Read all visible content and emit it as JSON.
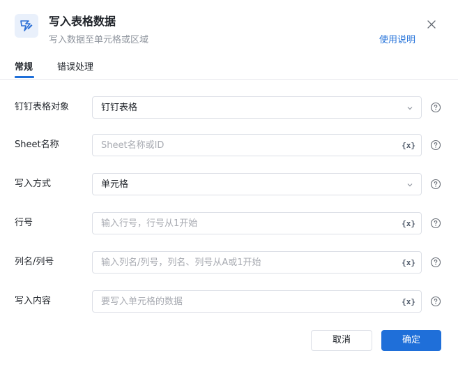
{
  "header": {
    "title": "写入表格数据",
    "subtitle": "写入数据至单元格或区域",
    "help_link": "使用说明"
  },
  "tabs": [
    {
      "label": "常规",
      "active": true
    },
    {
      "label": "错误处理",
      "active": false
    }
  ],
  "form": {
    "rows": [
      {
        "label": "钉钉表格对象",
        "type": "select",
        "value": "钉钉表格",
        "placeholder": ""
      },
      {
        "label": "Sheet名称",
        "type": "input",
        "value": "",
        "placeholder": "Sheet名称或ID"
      },
      {
        "label": "写入方式",
        "type": "select",
        "value": "单元格",
        "placeholder": ""
      },
      {
        "label": "行号",
        "type": "input",
        "value": "",
        "placeholder": "输入行号，行号从1开始"
      },
      {
        "label": "列名/列号",
        "type": "input",
        "value": "",
        "placeholder": "输入列名/列号，列名、列号从A或1开始"
      },
      {
        "label": "写入内容",
        "type": "input",
        "value": "",
        "placeholder": "要写入单元格的数据"
      }
    ],
    "var_icon_text": "{x}"
  },
  "footer": {
    "cancel_label": "取消",
    "ok_label": "确定"
  },
  "colors": {
    "accent": "#1f6fd9",
    "border": "#dcdfe6",
    "placeholder": "#a8abb2"
  },
  "icons": [
    "app-icon",
    "close-icon",
    "chevron-down-icon",
    "variable-icon",
    "help-icon"
  ]
}
